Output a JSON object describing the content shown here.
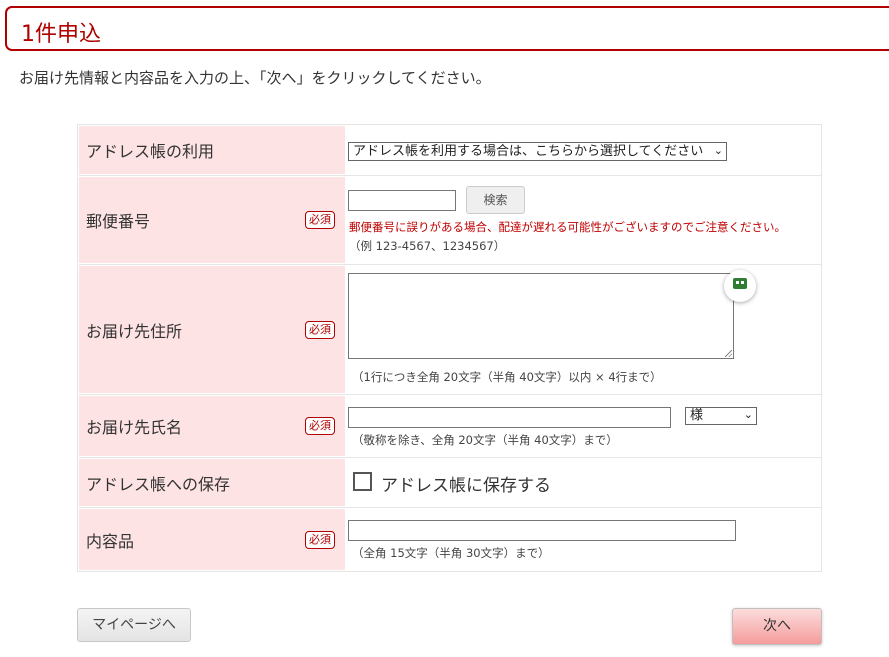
{
  "page": {
    "title": "1件申込",
    "instruction": "お届け先情報と内容品を入力の上、「次へ」をクリックしてください。"
  },
  "form": {
    "required_badge": "必須",
    "address_book": {
      "label": "アドレス帳の利用",
      "select_value": "アドレス帳を利用する場合は、こちらから選択してください"
    },
    "postal_code": {
      "label": "郵便番号",
      "value": "",
      "search_button": "検索",
      "warning": "郵便番号に誤りがある場合、配達が遅れる可能性がございますのでご注意ください。",
      "example": "（例 123-4567、1234567）"
    },
    "address": {
      "label": "お届け先住所",
      "value": "",
      "note": "（1行につき全角 20文字（半角 40文字）以内 × 4行まで）"
    },
    "name": {
      "label": "お届け先氏名",
      "value": "",
      "honorific_value": "様",
      "note": "（敬称を除き、全角 20文字（半角 40文字）まで）"
    },
    "save_to_address_book": {
      "label": "アドレス帳への保存",
      "checkbox_label": "アドレス帳に保存する",
      "checked": false
    },
    "contents": {
      "label": "内容品",
      "value": "",
      "note": "（全角 15文字（半角 30文字）まで）"
    }
  },
  "buttons": {
    "mypage": "マイページへ",
    "next": "次へ"
  },
  "colors": {
    "accent": "#b00000",
    "label_bg": "#fde3e4",
    "next_button": "#f59c9c"
  },
  "icons": {
    "keyboard_badge": "keyboard-icon",
    "chevron": "chevron-down-icon"
  }
}
